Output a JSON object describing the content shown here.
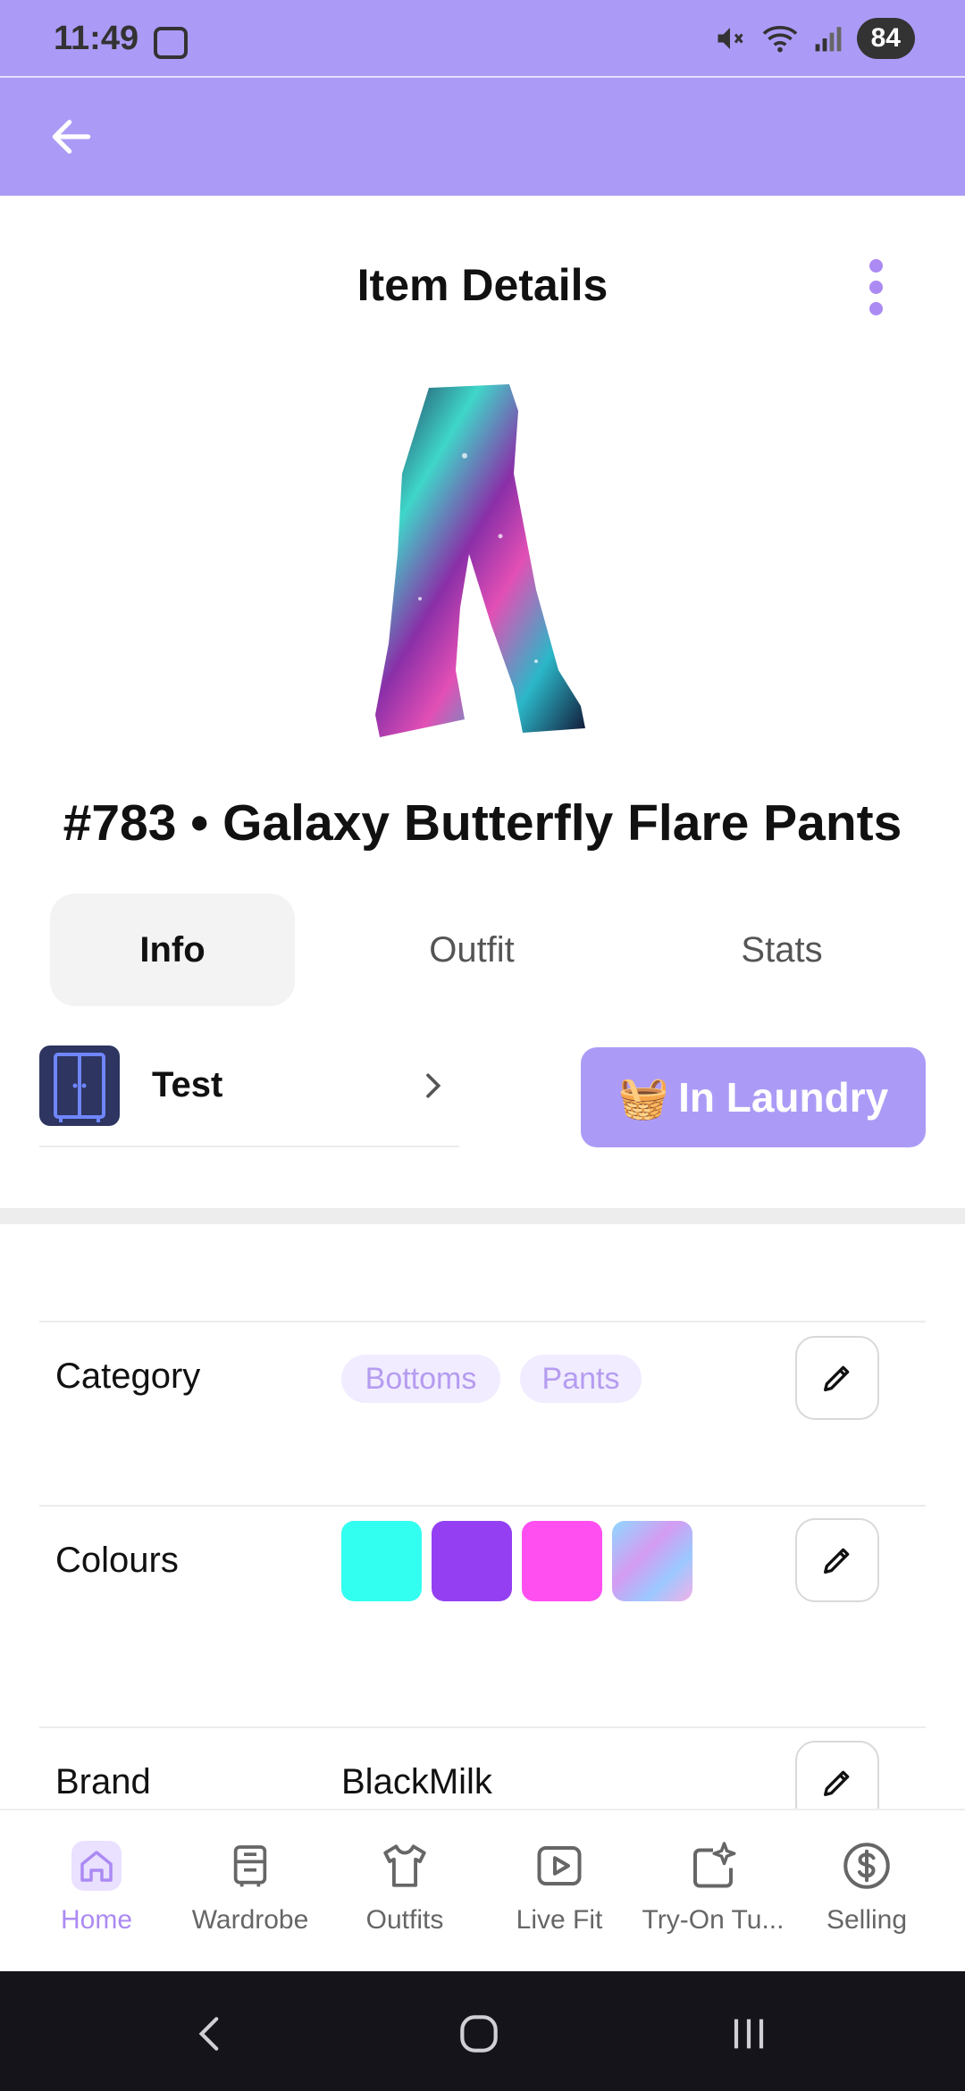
{
  "status_bar": {
    "time": "11:49",
    "battery": "84",
    "icons": [
      "screenshot-icon",
      "mute-icon",
      "wifi-icon",
      "signal-icon"
    ]
  },
  "page": {
    "title": "Item Details",
    "item_name": "#783 • Galaxy Butterfly Flare Pants"
  },
  "tabs": [
    {
      "label": "Info",
      "active": true
    },
    {
      "label": "Outfit",
      "active": false
    },
    {
      "label": "Stats",
      "active": false
    }
  ],
  "wardrobe": {
    "name": "Test"
  },
  "laundry": {
    "emoji": "🧺",
    "label": "In Laundry"
  },
  "fields": {
    "category": {
      "label": "Category",
      "tags": [
        "Bottoms",
        "Pants"
      ]
    },
    "colours": {
      "label": "Colours",
      "swatches": [
        "#33FFF0",
        "#9440F2",
        "#FF4FF0",
        "gradient"
      ]
    },
    "brand": {
      "label": "Brand",
      "value": "BlackMilk"
    }
  },
  "bottom_nav": [
    {
      "label": "Home",
      "icon": "home-icon",
      "active": true
    },
    {
      "label": "Wardrobe",
      "icon": "wardrobe-icon",
      "active": false
    },
    {
      "label": "Outfits",
      "icon": "shirt-icon",
      "active": false
    },
    {
      "label": "Live Fit",
      "icon": "play-icon",
      "active": false
    },
    {
      "label": "Try-On Tu...",
      "icon": "sparkle-icon",
      "active": false
    },
    {
      "label": "Selling",
      "icon": "dollar-icon",
      "active": false
    }
  ],
  "colors": {
    "accent": "#AC9BF6",
    "accent_dark": "#AC8AF3",
    "chip_bg": "#F1ECFF",
    "system_nav": "#15141A"
  }
}
